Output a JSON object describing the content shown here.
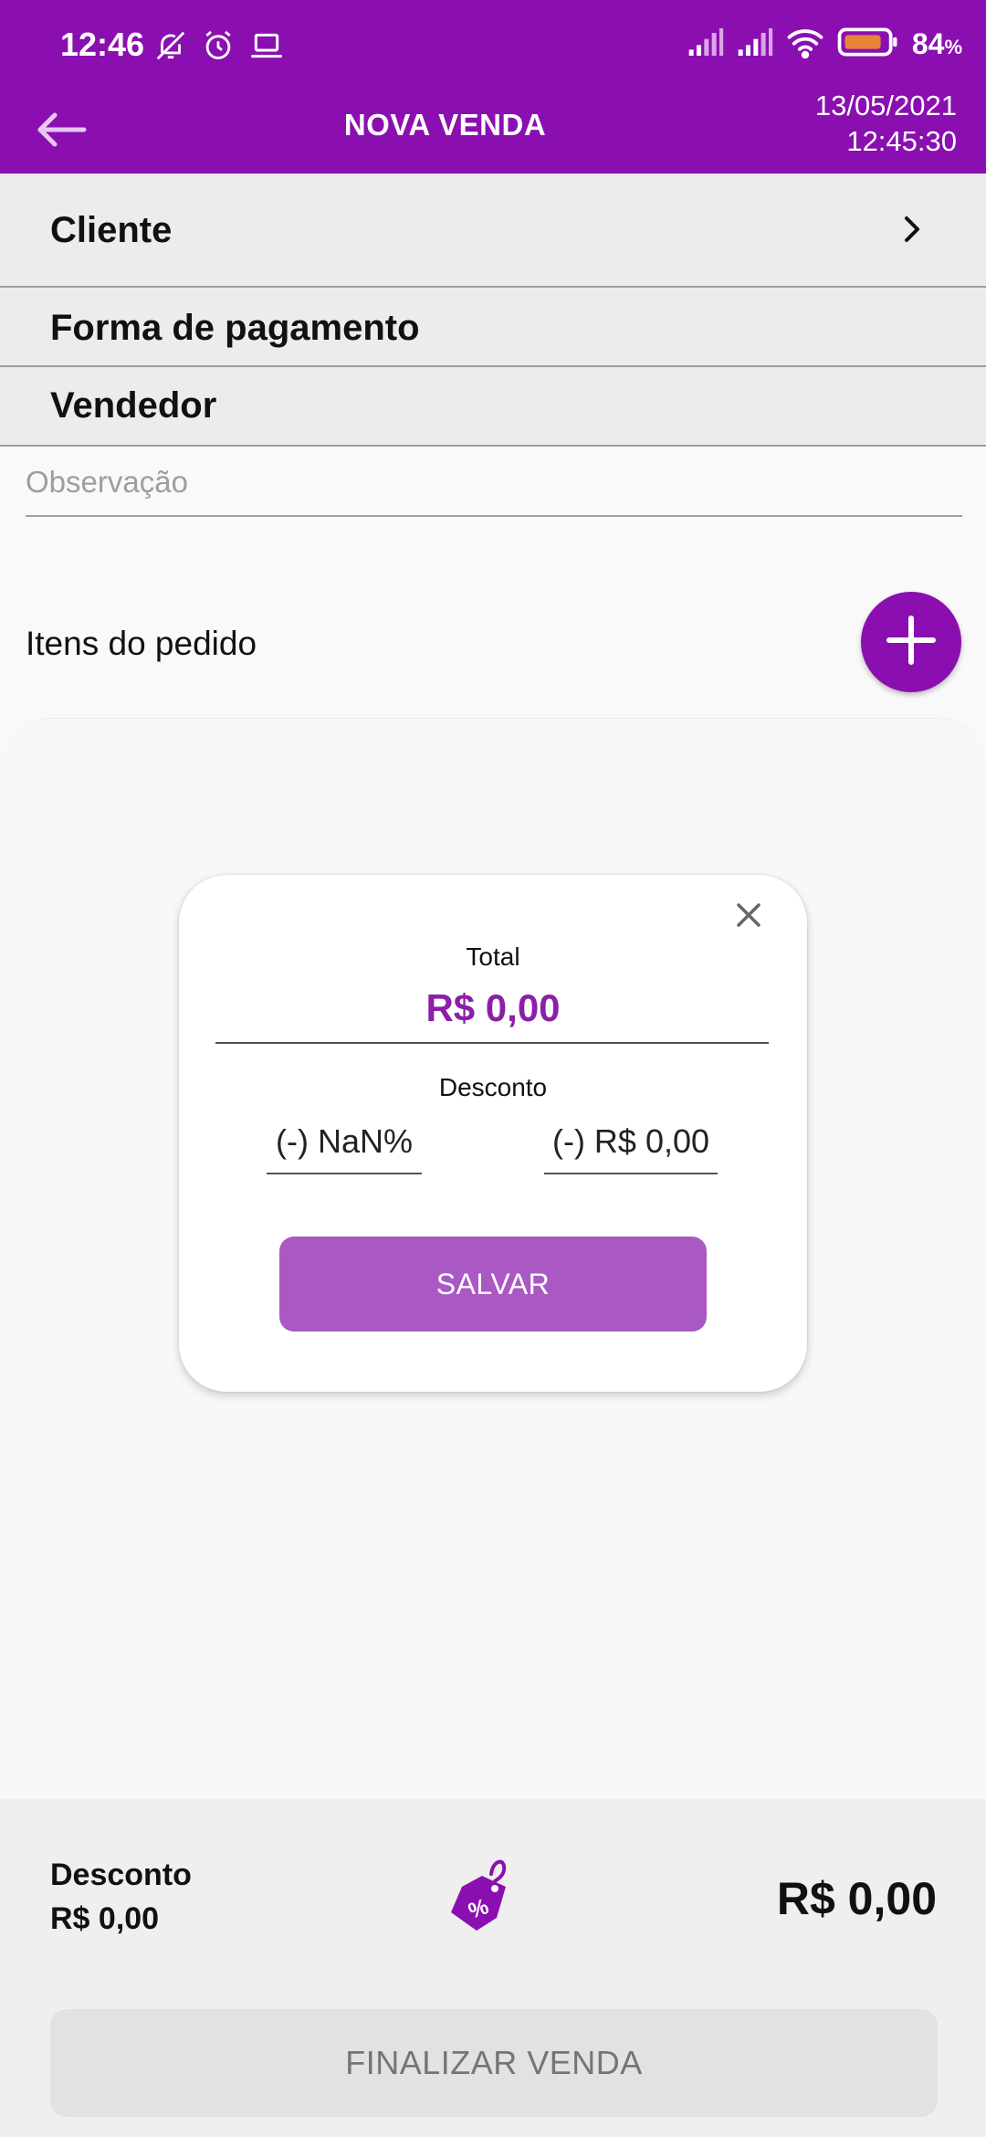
{
  "status_bar": {
    "time": "12:46",
    "battery_percent": "84",
    "battery_unit": "%",
    "icons_left": [
      "notifications-off-icon",
      "alarm-icon",
      "laptop-icon"
    ],
    "icons_right": [
      "signal-icon",
      "signal-icon",
      "wifi-icon",
      "battery-icon"
    ]
  },
  "app_bar": {
    "title": "NOVA VENDA",
    "date": "13/05/2021",
    "time": "12:45:30",
    "back_icon": "arrow-back-icon"
  },
  "form": {
    "cliente_label": "Cliente",
    "pagamento_label": "Forma de pagamento",
    "vendedor_label": "Vendedor",
    "observacao_placeholder": "Observação",
    "observacao_value": ""
  },
  "items": {
    "title": "Itens do pedido",
    "add_icon": "plus-icon"
  },
  "dialog": {
    "total_label": "Total",
    "total_value": "R$ 0,00",
    "discount_label": "Desconto",
    "discount_percent": "(-) NaN%",
    "discount_amount": "(-) R$ 0,00",
    "save_label": "SALVAR",
    "close_icon": "close-icon"
  },
  "footer": {
    "discount_label": "Desconto",
    "discount_value": "R$ 0,00",
    "tag_icon": "discount-tag-icon",
    "tag_text": "%",
    "total_value": "R$ 0,00",
    "finalize_label": "FINALIZAR VENDA"
  },
  "colors": {
    "primary": "#8b0fb0",
    "total_text": "#8b1fa8",
    "save_button": "#a958c4",
    "disabled_button": "#e2e2e2",
    "battery_fill": "#e8843a"
  }
}
